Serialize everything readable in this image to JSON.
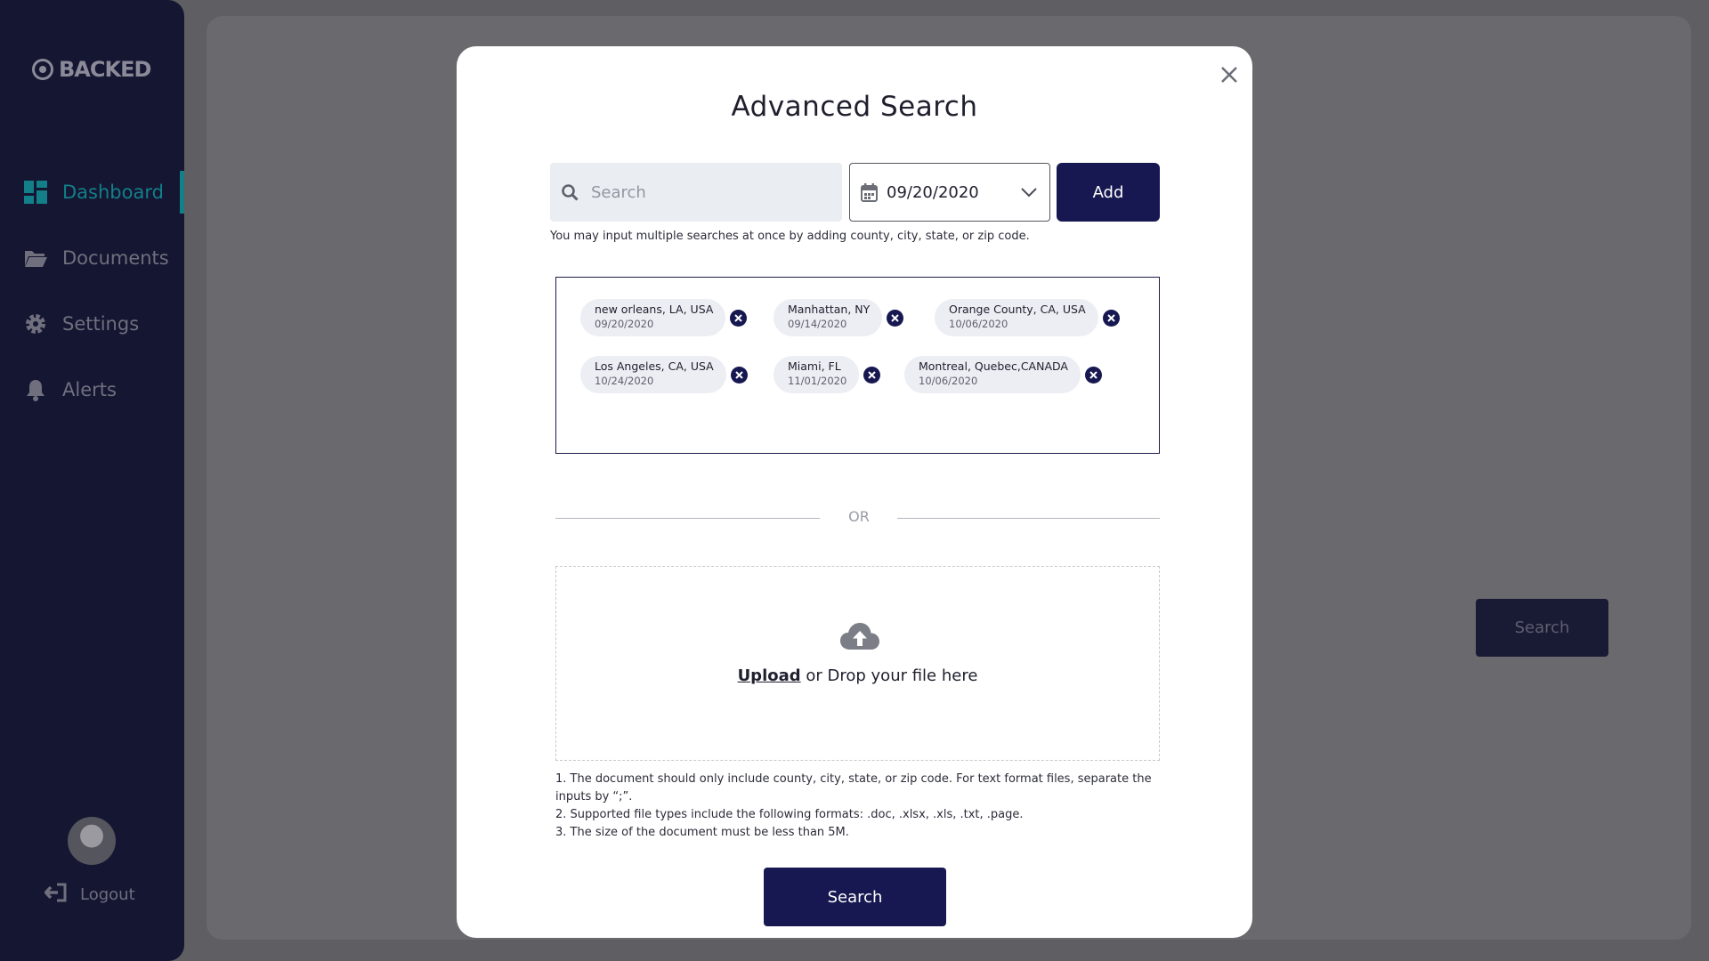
{
  "app": {
    "logo_text": "BACKED",
    "nav": [
      {
        "label": "Dashboard",
        "icon": "dashboard-icon",
        "active": true
      },
      {
        "label": "Documents",
        "icon": "folder-icon",
        "active": false
      },
      {
        "label": "Settings",
        "icon": "gear-icon",
        "active": false
      },
      {
        "label": "Alerts",
        "icon": "bell-icon",
        "active": false
      }
    ],
    "logout_label": "Logout",
    "background_search_label": "Search",
    "colors": {
      "accent": "#137f89",
      "primary": "#171851",
      "sidebar": "#151632"
    }
  },
  "modal": {
    "title": "Advanced Search",
    "search_placeholder": "Search",
    "date_value": "09/20/2020",
    "add_label": "Add",
    "hint": "You may input multiple searches at once by adding county, city, state, or zip code.",
    "tags": [
      {
        "location": "new orleans, LA, USA",
        "date": "09/20/2020"
      },
      {
        "location": "Manhattan, NY",
        "date": "09/14/2020"
      },
      {
        "location": "Orange County, CA, USA",
        "date": "10/06/2020"
      },
      {
        "location": "Los Angeles, CA, USA",
        "date": "10/24/2020"
      },
      {
        "location": "Miami, FL",
        "date": "11/01/2020"
      },
      {
        "location": "Montreal, Quebec,CANADA",
        "date": "10/06/2020"
      }
    ],
    "or_label": "OR",
    "upload": {
      "link_label": "Upload",
      "rest_label": " or Drop your file here"
    },
    "notes": [
      "1. The document should only include county, city, state, or zip code. For text format files, separate the inputs by “;”.",
      "2. Supported file types include the following formats: .doc, .xlsx, .xls, .txt, .page.",
      "3. The size of the document must be less than 5M."
    ],
    "search_label": "Search"
  }
}
